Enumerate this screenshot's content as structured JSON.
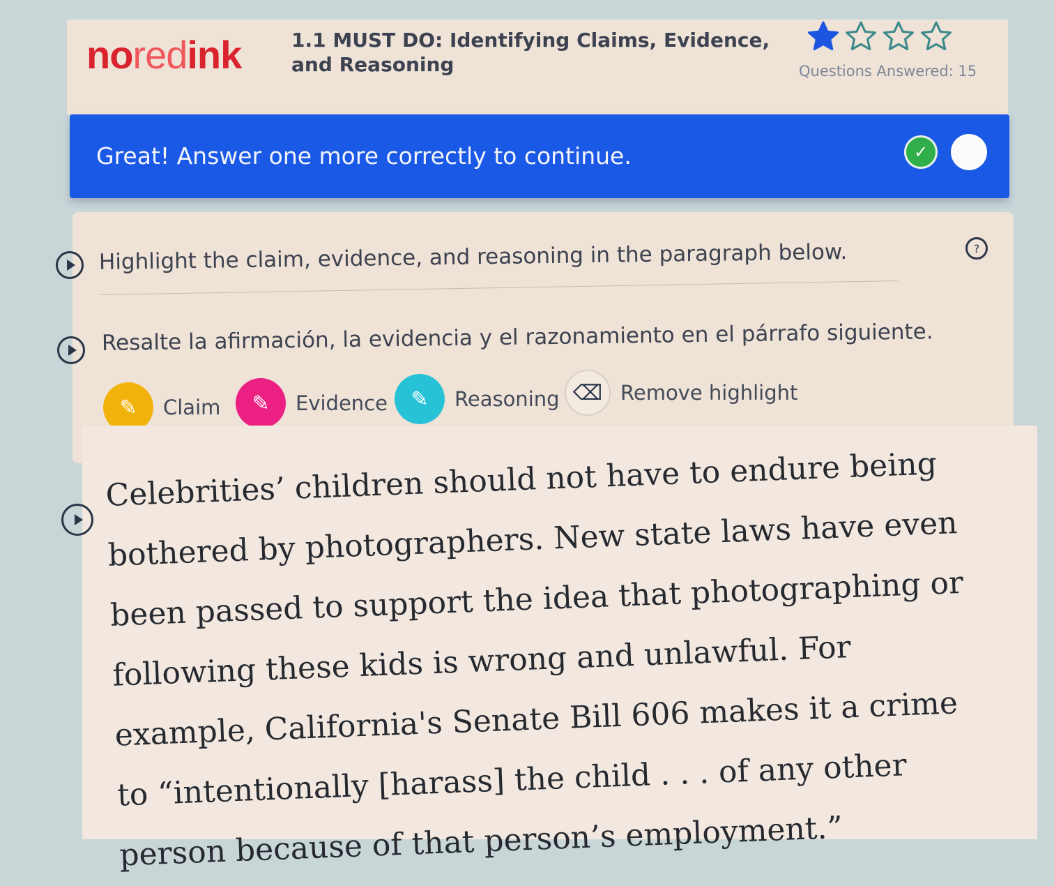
{
  "header": {
    "logo": {
      "no": "no",
      "red": "red",
      "ink": "ink"
    },
    "assignment_title": "1.1 MUST DO: Identifying Claims, Evidence, and Reasoning",
    "stars_filled": 1,
    "stars_total": 4,
    "questions_answered_label": "Questions Answered: 15"
  },
  "banner": {
    "message": "Great! Answer one more correctly to continue.",
    "accent": "#1a59e6"
  },
  "instructions": {
    "english": "Highlight the claim, evidence, and reasoning in the paragraph below.",
    "spanish": "Resalte la afirmación, la evidencia y el razonamiento en el párrafo siguiente."
  },
  "tools": [
    {
      "label": "Claim",
      "color": "#f2b20c",
      "icon": "highlighter-icon"
    },
    {
      "label": "Evidence",
      "color": "#ec1f83",
      "icon": "highlighter-icon"
    },
    {
      "label": "Reasoning",
      "color": "#27c2d6",
      "icon": "highlighter-icon"
    },
    {
      "label": "Remove highlight",
      "icon": "eraser-icon"
    }
  ],
  "passage": {
    "text": "Celebrities’ children should not have to endure being bothered by photographers. New state laws have even been passed to support the idea that photographing or following these kids is wrong and unlawful. For example, California's Senate Bill 606 makes it a crime to “intentionally [harass] the child . . . of any other person because of that person’s employment.”"
  }
}
